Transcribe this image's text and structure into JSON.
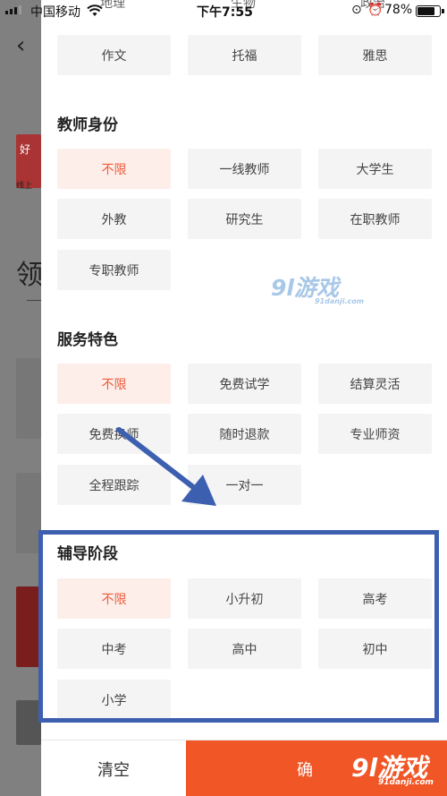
{
  "status_bar": {
    "carrier": "中国移动",
    "time": "下午7:55",
    "battery": "78%",
    "icons": "⊙ ⏰"
  },
  "background": {
    "back_icon": "chevron-left-icon",
    "thumb_text_1": "好",
    "thumb_text_2": "线上",
    "partial_char": "领"
  },
  "top_cut_labels": [
    "地理",
    "生物",
    "政治"
  ],
  "subjects": {
    "chips": [
      "作文",
      "托福",
      "雅思"
    ]
  },
  "teacher_identity": {
    "title": "教师身份",
    "chips": [
      "不限",
      "一线教师",
      "大学生",
      "外教",
      "研究生",
      "在职教师",
      "专职教师"
    ],
    "selected": "不限"
  },
  "service_features": {
    "title": "服务特色",
    "chips": [
      "不限",
      "免费试学",
      "结算灵活",
      "免费换师",
      "随时退款",
      "专业师资",
      "全程跟踪",
      "一对一"
    ],
    "selected": "不限"
  },
  "tutoring_stage": {
    "title": "辅导阶段",
    "chips": [
      "不限",
      "小升初",
      "高考",
      "中考",
      "高中",
      "初中",
      "小学"
    ],
    "selected": "不限"
  },
  "bottom": {
    "clear": "清空",
    "confirm": "确"
  },
  "watermark": {
    "main": "9l游戏",
    "sub": "91danji.com"
  },
  "colors": {
    "accent": "#ee5a3c",
    "confirm_bg": "#f05626",
    "annotation": "#3d5fb0"
  }
}
